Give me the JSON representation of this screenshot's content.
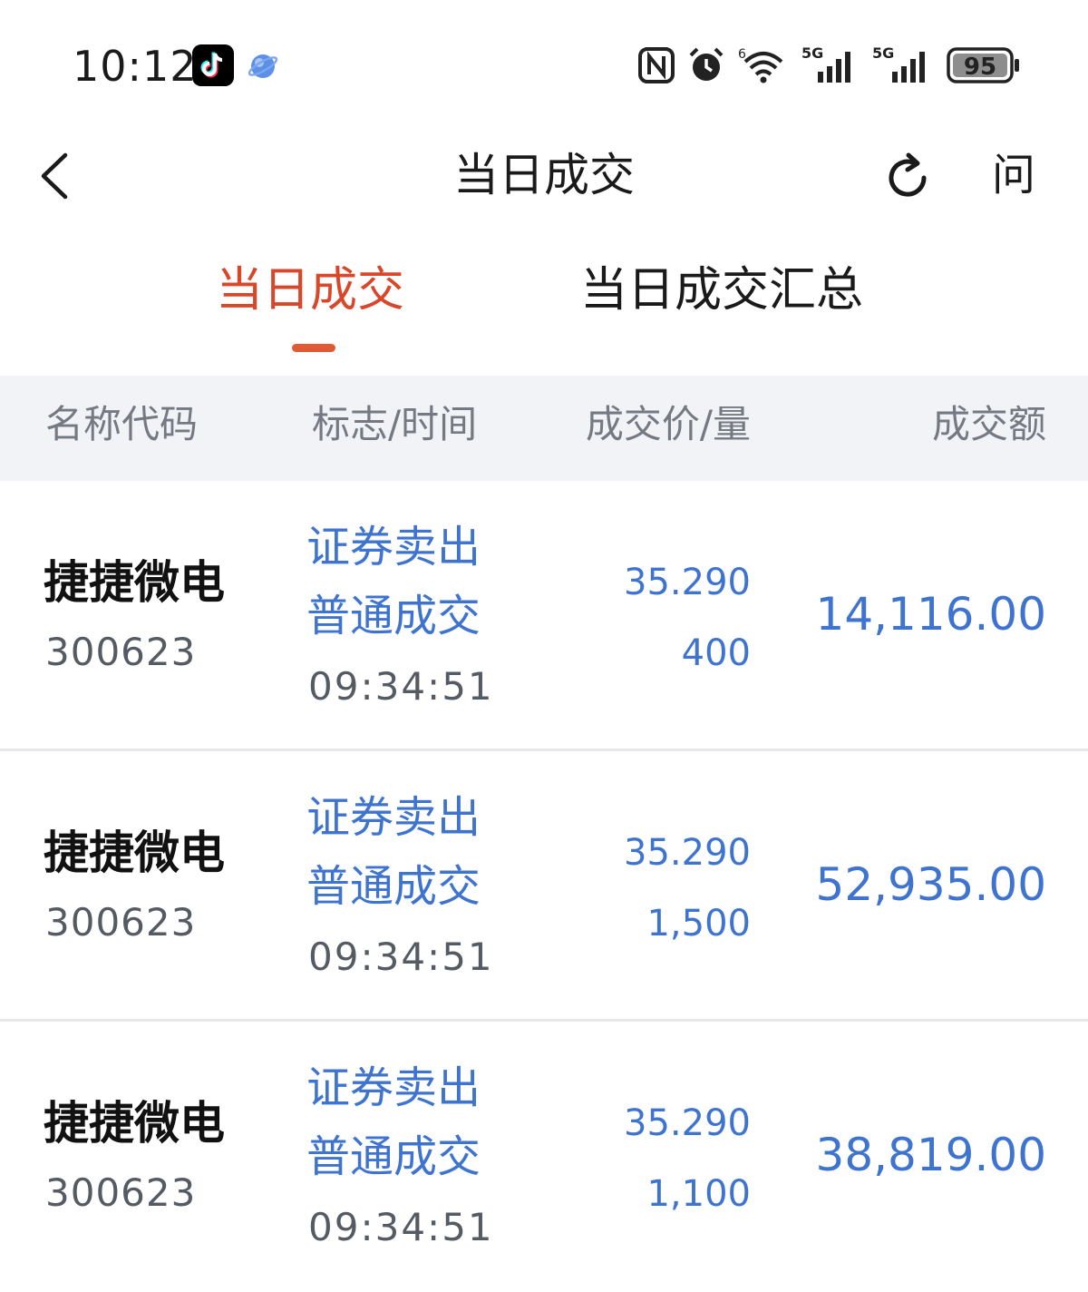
{
  "status_bar": {
    "time": "10:12",
    "battery": "95",
    "network_1": "5G",
    "network_2": "5G",
    "wifi_label": "6",
    "icons": [
      "tiktok-icon",
      "browser-icon",
      "nfc-icon",
      "alarm-icon",
      "wifi-icon",
      "signal-icon",
      "battery-icon"
    ]
  },
  "nav": {
    "title": "当日成交",
    "ask_label": "问",
    "icons": [
      "back-icon",
      "refresh-icon"
    ]
  },
  "tabs": [
    {
      "label": "当日成交",
      "active": true
    },
    {
      "label": "当日成交汇总",
      "active": false
    }
  ],
  "table": {
    "headers": {
      "name_code": "名称代码",
      "flag_time": "标志/时间",
      "price_qty": "成交价/量",
      "amount": "成交额"
    },
    "rows": [
      {
        "name": "捷捷微电",
        "code": "300623",
        "flag1": "证券卖出",
        "flag2": "普通成交",
        "time": "09:34:51",
        "price": "35.290",
        "qty": "400",
        "amount": "14,116.00"
      },
      {
        "name": "捷捷微电",
        "code": "300623",
        "flag1": "证券卖出",
        "flag2": "普通成交",
        "time": "09:34:51",
        "price": "35.290",
        "qty": "1,500",
        "amount": "52,935.00"
      },
      {
        "name": "捷捷微电",
        "code": "300623",
        "flag1": "证券卖出",
        "flag2": "普通成交",
        "time": "09:34:51",
        "price": "35.290",
        "qty": "1,100",
        "amount": "38,819.00"
      }
    ]
  },
  "colors": {
    "accent": "#d9472b",
    "blue": "#3e74d0",
    "header_bg": "#f1f3f7",
    "muted": "#757a82"
  }
}
